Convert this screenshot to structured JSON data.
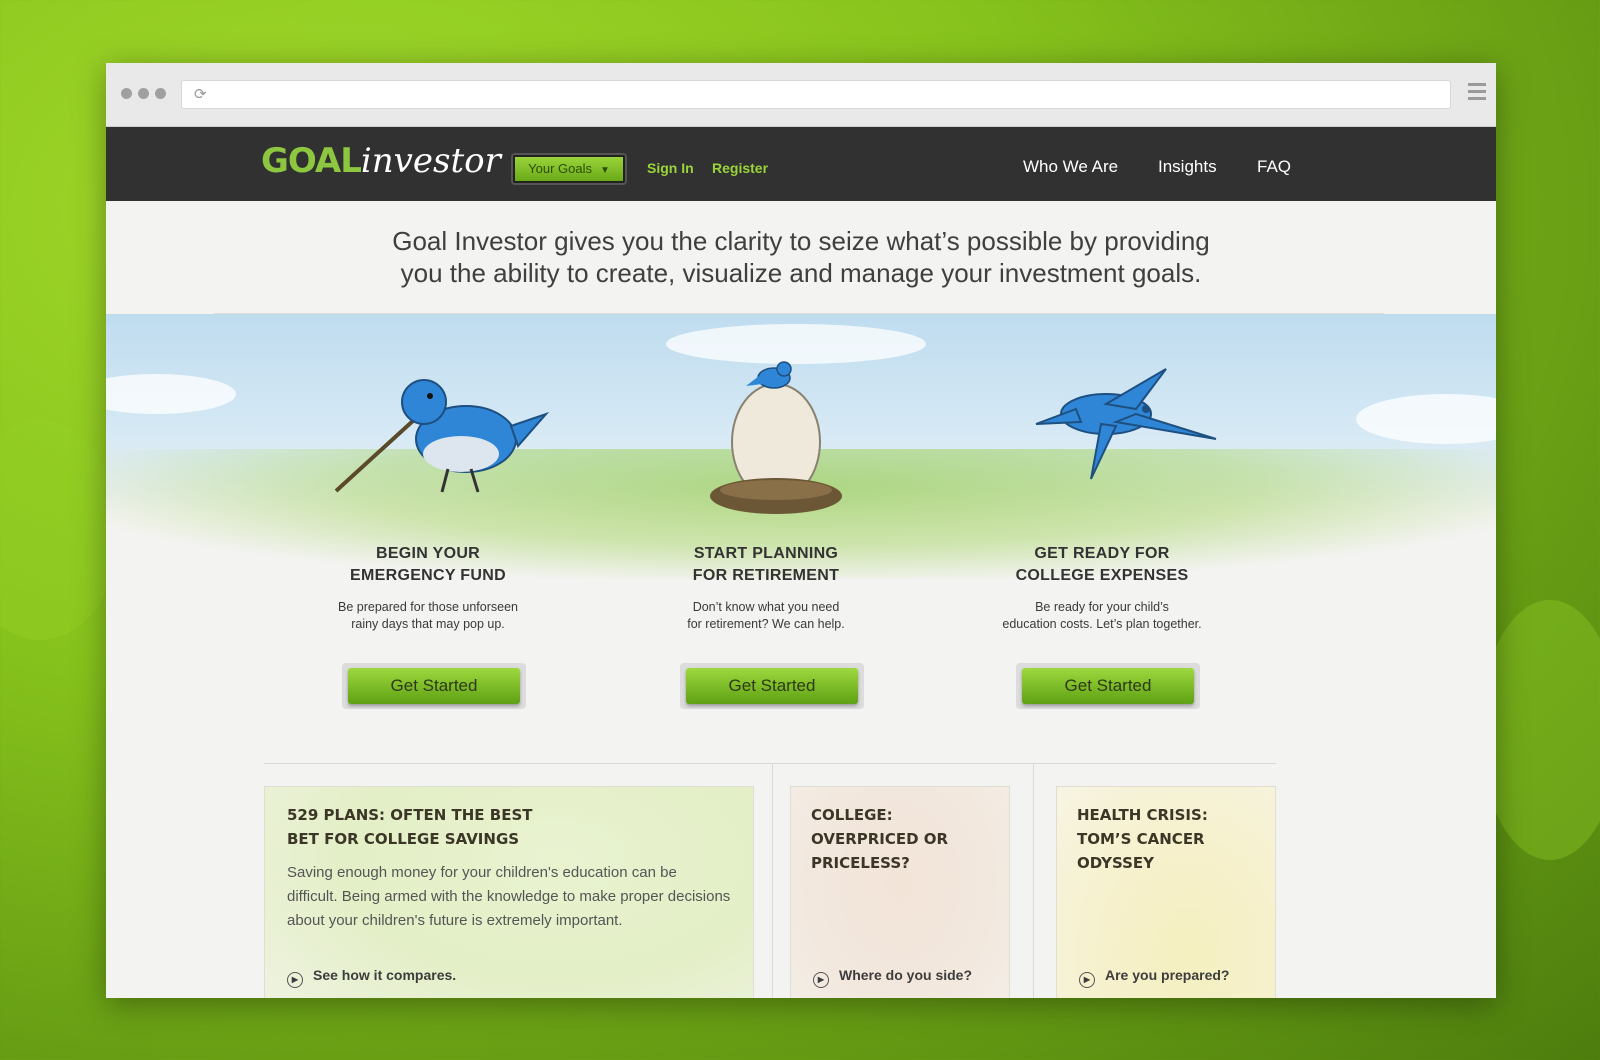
{
  "nav": {
    "logo_goal": "GOAL",
    "logo_investor": "investor",
    "your_goals_label": "Your Goals",
    "sign_in": "Sign In",
    "register": "Register",
    "links": [
      "Who We Are",
      "Insights",
      "FAQ"
    ]
  },
  "hero": {
    "tagline_line1": "Goal Investor gives you the clarity to seize what’s possible by providing",
    "tagline_line2": "you the ability to create, visualize and manage your investment goals."
  },
  "goals": [
    {
      "title_line1": "BEGIN YOUR",
      "title_line2": "EMERGENCY FUND",
      "desc_line1": "Be prepared for those unforseen",
      "desc_line2": "rainy days that may pop up.",
      "button": "Get Started"
    },
    {
      "title_line1": "START PLANNING",
      "title_line2": "FOR RETIREMENT",
      "desc_line1": "Don’t know what you need",
      "desc_line2": "for retirement? We can help.",
      "button": "Get Started"
    },
    {
      "title_line1": "GET READY FOR",
      "title_line2": "COLLEGE EXPENSES",
      "desc_line1": "Be ready for your child’s",
      "desc_line2": "education costs. Let’s plan together.",
      "button": "Get Started"
    }
  ],
  "articles": [
    {
      "title_line1": "529 PLANS: OFTEN THE BEST",
      "title_line2": "BET FOR COLLEGE SAVINGS",
      "body": "Saving enough money for your children's education can be difficult. Being armed with the knowledge to make proper decisions about your children's future is extremely important.",
      "link": "See how it compares."
    },
    {
      "title_line1": "COLLEGE:",
      "title_line2": "OVERPRICED OR",
      "title_line3": "PRICELESS?",
      "link": "Where do you side?"
    },
    {
      "title_line1": "HEALTH CRISIS:",
      "title_line2": "TOM’S CANCER",
      "title_line3": "ODYSSEY",
      "link": "Are you prepared?"
    }
  ],
  "icons": {
    "reload": "reload-icon",
    "menu": "hamburger-menu-icon",
    "dropdown": "caret-down-icon",
    "play": "play-circle-icon"
  },
  "colors": {
    "brand_green": "#8dc63f",
    "nav_bg": "#313131",
    "bird_blue": "#2f86d6"
  }
}
